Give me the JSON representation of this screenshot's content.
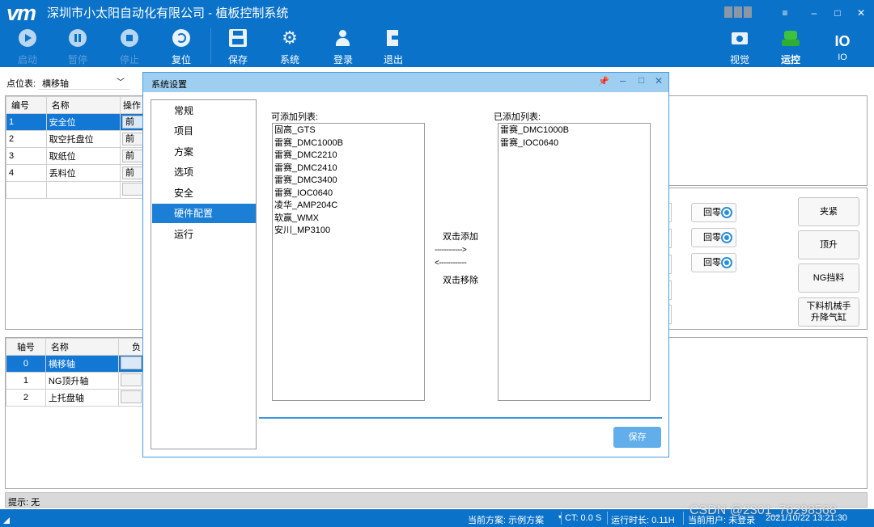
{
  "app": {
    "logo": "vm",
    "title": "深圳市小太阳自动化有限公司 - 植板控制系统"
  },
  "toolbar": {
    "start": "启动",
    "pause": "暂停",
    "stop": "停止",
    "reset": "复位",
    "save": "保存",
    "system": "系统",
    "login": "登录",
    "exit": "退出",
    "vision": "视觉",
    "control": "运控",
    "io_glyph": "IO",
    "io_label": "IO"
  },
  "points": {
    "selector_label": "点位表:",
    "selector_value": "横移轴",
    "headers": [
      "编号",
      "名称",
      "操作"
    ],
    "rows": [
      {
        "id": "1",
        "name": "安全位",
        "op": "前"
      },
      {
        "id": "2",
        "name": "取空托盘位",
        "op": "前"
      },
      {
        "id": "3",
        "name": "取纸位",
        "op": "前"
      },
      {
        "id": "4",
        "name": "丢料位",
        "op": "前"
      }
    ]
  },
  "axes": {
    "headers": [
      "轴号",
      "名称",
      "负"
    ],
    "rows": [
      {
        "id": "0",
        "name": "横移轴"
      },
      {
        "id": "1",
        "name": "NG顶升轴"
      },
      {
        "id": "2",
        "name": "上托盘轴"
      }
    ]
  },
  "right_panel": {
    "home_buttons": [
      "回零",
      "回零",
      "回零"
    ],
    "action_buttons": [
      "夹紧",
      "顶升",
      "NG挡料",
      "下料机械手\n升降气缸"
    ]
  },
  "dialog": {
    "title": "系统设置",
    "nav": [
      "常规",
      "项目",
      "方案",
      "选项",
      "安全",
      "硬件配置",
      "运行"
    ],
    "active_nav": "硬件配置",
    "available_label": "可添加列表:",
    "available": [
      "固高_GTS",
      "雷赛_DMC1000B",
      "雷赛_DMC2210",
      "雷赛_DMC2410",
      "雷赛_DMC3400",
      "雷赛_IOC0640",
      "凌华_AMP204C",
      "软赢_WMX",
      "安川_MP3100"
    ],
    "added_label": "已添加列表:",
    "added": [
      "雷赛_DMC1000B",
      "雷赛_IOC0640"
    ],
    "hint_add": "双击添加",
    "arrow_right": "------------>",
    "arrow_left": "<------------",
    "hint_remove": "双击移除",
    "save": "保存"
  },
  "hint": {
    "label": "提示: 无"
  },
  "status": {
    "scheme": "当前方案: 示例方案",
    "ct": "CT: 0.0 S",
    "runtime": "运行时长: 0.11H",
    "user": "当前用户: 未登录",
    "datetime": "2021/10/22 13:21:30",
    "watermark": "CSDN @2301_76298568"
  },
  "colors": {
    "primary": "#0a72c9",
    "selection": "#1378d4",
    "dialog_header": "#9ecff0"
  }
}
